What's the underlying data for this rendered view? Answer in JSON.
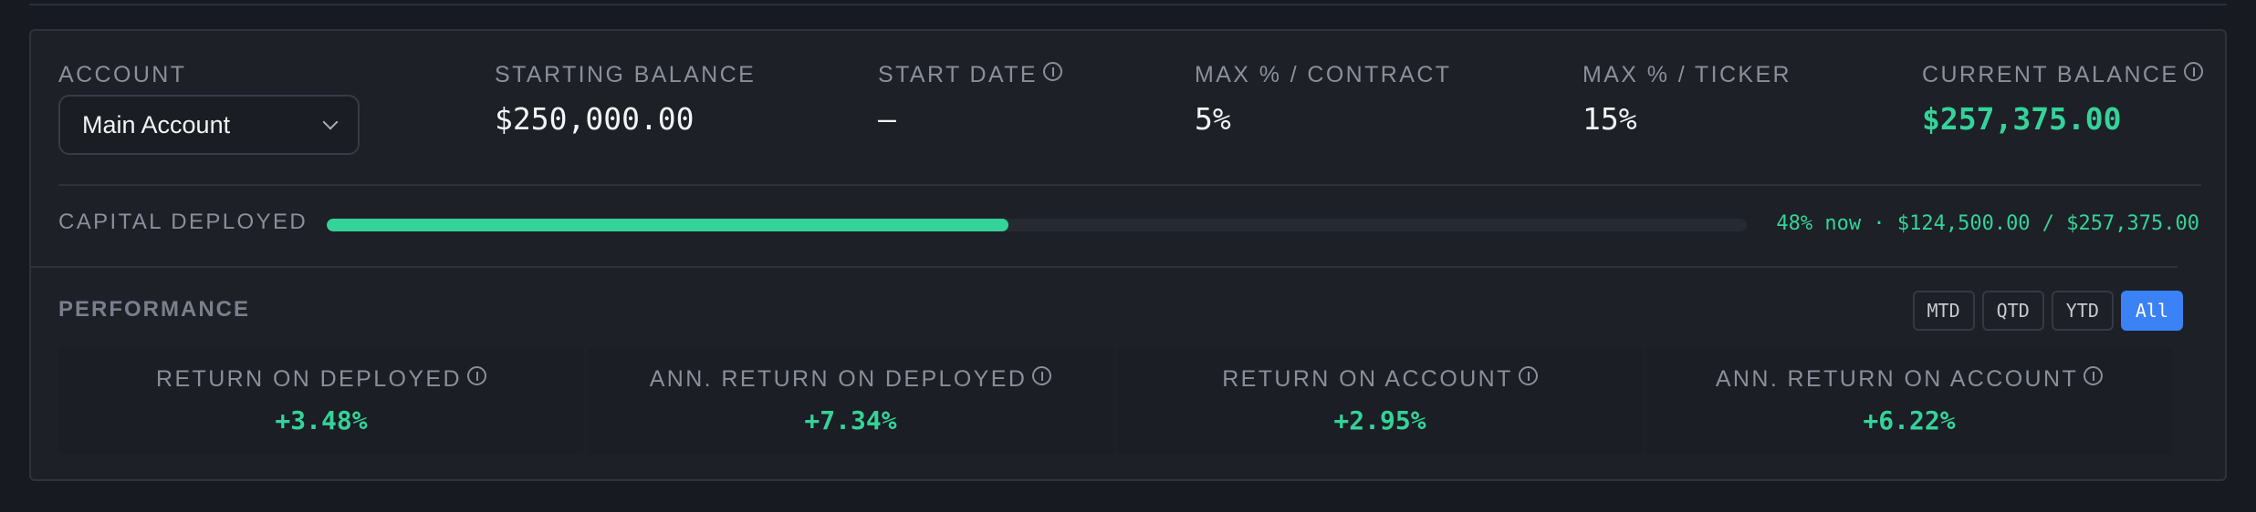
{
  "account": {
    "label": "ACCOUNT",
    "selected": "Main Account"
  },
  "stats": [
    {
      "label": "STARTING BALANCE",
      "value": "$250,000.00",
      "info": false
    },
    {
      "label": "START DATE",
      "value": "—",
      "info": true
    },
    {
      "label": "MAX % / CONTRACT",
      "value": "5%",
      "info": false
    },
    {
      "label": "MAX % / TICKER",
      "value": "15%",
      "info": false
    },
    {
      "label": "CURRENT BALANCE",
      "value": "$257,375.00",
      "info": true
    }
  ],
  "capital": {
    "label": "CAPITAL DEPLOYED",
    "fraction": 0.48,
    "summary": "48% now · $124,500.00 / $257,375.00"
  },
  "performance": {
    "title": "PERFORMANCE",
    "ranges": [
      "MTD",
      "QTD",
      "YTD",
      "All"
    ],
    "active_range": "All",
    "metrics": [
      {
        "label": "RETURN ON DEPLOYED",
        "value": "+3.48%"
      },
      {
        "label": "ANN. RETURN ON DEPLOYED",
        "value": "+7.34%"
      },
      {
        "label": "RETURN ON ACCOUNT",
        "value": "+2.95%"
      },
      {
        "label": "ANN. RETURN ON ACCOUNT",
        "value": "+6.22%"
      }
    ]
  },
  "colors": {
    "accent_green": "#34d399",
    "active_blue": "#3b82f6"
  }
}
